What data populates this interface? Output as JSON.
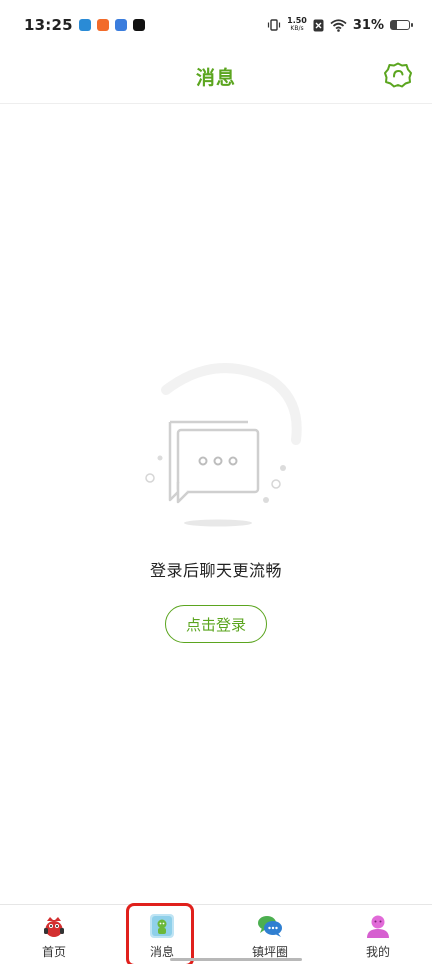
{
  "status_bar": {
    "time": "13:25",
    "net_speed_value": "1.50",
    "net_speed_unit": "KB/s",
    "battery_percent": "31%",
    "battery_level": 0.31
  },
  "header": {
    "title": "消息"
  },
  "empty_state": {
    "message": "登录后聊天更流畅",
    "login_label": "点击登录"
  },
  "bottom_nav": {
    "items": [
      {
        "label": "首页",
        "icon": "home-mascot-icon"
      },
      {
        "label": "消息",
        "icon": "message-icon"
      },
      {
        "label": "镇坪圈",
        "icon": "chat-bubbles-icon"
      },
      {
        "label": "我的",
        "icon": "profile-icon"
      }
    ],
    "active_index": 1
  },
  "colors": {
    "accent": "#5ba51f",
    "highlight": "#e0201c"
  }
}
